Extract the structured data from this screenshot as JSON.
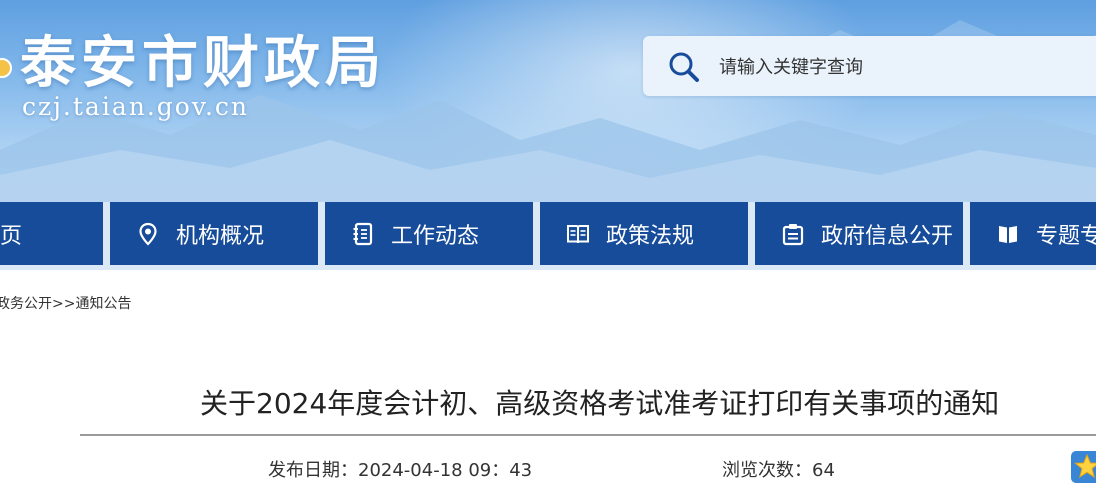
{
  "header": {
    "site_title": "泰安市财政局",
    "site_domain": "czj.taian.gov.cn",
    "search_placeholder": "请输入关键字查询"
  },
  "nav": {
    "items": [
      {
        "label": "页",
        "icon": "home-icon"
      },
      {
        "label": "机构概况",
        "icon": "location-pin-icon"
      },
      {
        "label": "工作动态",
        "icon": "notebook-icon"
      },
      {
        "label": "政策法规",
        "icon": "open-book-icon"
      },
      {
        "label": "政府信息公开",
        "icon": "document-icon"
      },
      {
        "label": "专题专",
        "icon": "book-icon"
      }
    ]
  },
  "breadcrumb": {
    "parent": "政务公开",
    "separator": ">>",
    "current": "通知公告"
  },
  "article": {
    "title": "关于2024年度会计初、高级资格考试准考证打印有关事项的通知",
    "publish_label": "发布日期：",
    "publish_date": "2024-04-18 09：43",
    "views_label": "浏览次数：",
    "views": "64"
  },
  "colors": {
    "nav_background": "#174c9b",
    "banner_sky": "#7fb6ea",
    "title_rule": "#9a9a9a"
  }
}
